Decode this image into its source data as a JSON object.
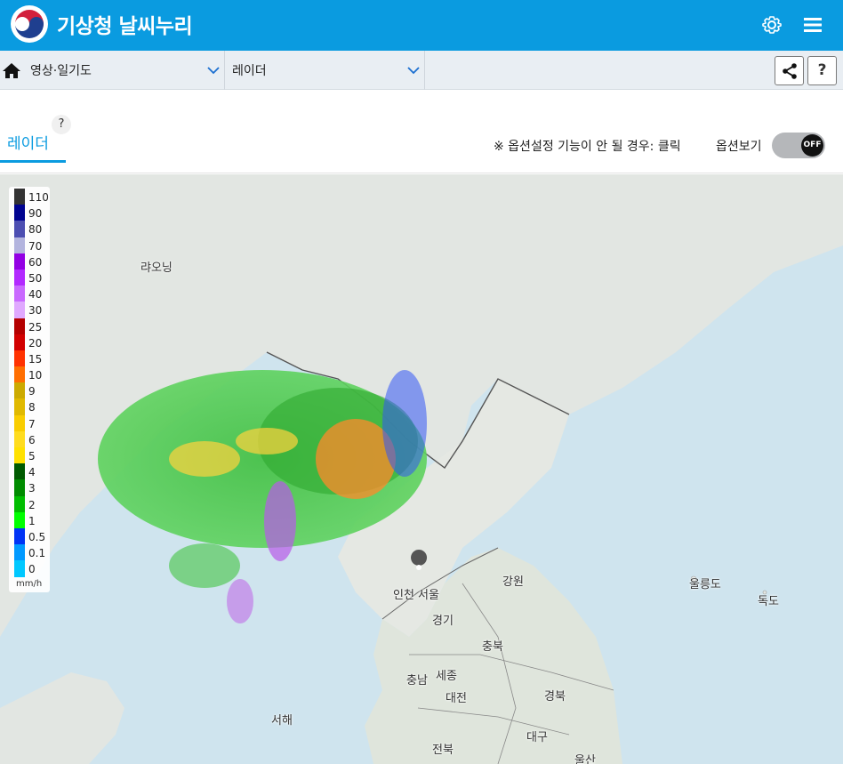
{
  "app": {
    "title": "기상청 날씨누리"
  },
  "icons": {
    "settings": "gear-icon",
    "menu": "hamburger-menu-icon",
    "home": "home-icon",
    "share": "share-icon"
  },
  "nav": {
    "category": {
      "selected": "영상·일기도"
    },
    "product": {
      "selected": "레이더"
    },
    "help_label": "?"
  },
  "tab": {
    "label": "레이더",
    "help": "?"
  },
  "options": {
    "note": "※ 옵션설정 기능이 안 될 경우: 클릭",
    "label": "옵션보기",
    "toggle_state": "OFF"
  },
  "legend": {
    "unit": "mm/h",
    "items": [
      {
        "value": "110",
        "color": "#333333"
      },
      {
        "value": "90",
        "color": "#000390"
      },
      {
        "value": "80",
        "color": "#4c4eb1"
      },
      {
        "value": "70",
        "color": "#b3b4de"
      },
      {
        "value": "60",
        "color": "#9300e4"
      },
      {
        "value": "50",
        "color": "#b229ff"
      },
      {
        "value": "40",
        "color": "#c969ff"
      },
      {
        "value": "30",
        "color": "#e0a9ff"
      },
      {
        "value": "25",
        "color": "#b40000"
      },
      {
        "value": "20",
        "color": "#d20000"
      },
      {
        "value": "15",
        "color": "#ff3200"
      },
      {
        "value": "10",
        "color": "#ff6e00"
      },
      {
        "value": "9",
        "color": "#ccaa00"
      },
      {
        "value": "8",
        "color": "#e0b900"
      },
      {
        "value": "7",
        "color": "#f9cd00"
      },
      {
        "value": "6",
        "color": "#ffdc1f"
      },
      {
        "value": "5",
        "color": "#ffe100"
      },
      {
        "value": "4",
        "color": "#005a00"
      },
      {
        "value": "3",
        "color": "#008c00"
      },
      {
        "value": "2",
        "color": "#00be00"
      },
      {
        "value": "1",
        "color": "#00ff00"
      },
      {
        "value": "0.5",
        "color": "#0033f5"
      },
      {
        "value": "0.1",
        "color": "#0099ff"
      },
      {
        "value": "0",
        "color": "#00c8ff"
      }
    ]
  },
  "map": {
    "places": {
      "liaoning": "랴오닝",
      "incheon": "인천",
      "seoul": "서울",
      "gyeonggi": "경기",
      "gangwon": "강원",
      "chungbuk": "충북",
      "chungnam": "충남",
      "sejong": "세종",
      "daejeon": "대전",
      "gyeongbuk": "경북",
      "daegu": "대구",
      "jeonbuk": "전북",
      "ulsan": "울산",
      "ulleungdo": "울릉도",
      "dokdo": "독도",
      "west_sea": "서해"
    }
  }
}
